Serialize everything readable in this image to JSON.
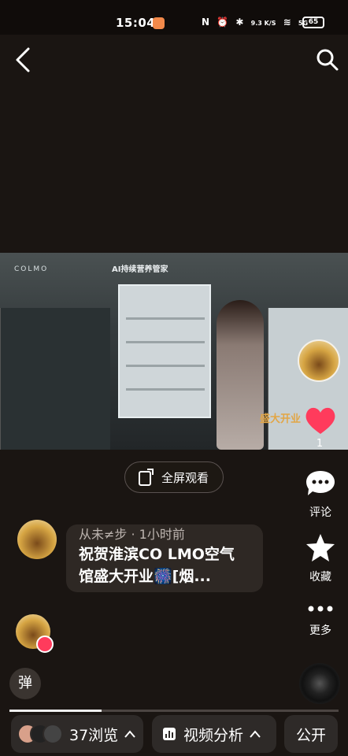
{
  "status_bar": {
    "time": "15:04",
    "net_speed": "9.3 K/S",
    "battery": "65",
    "signal_label": "5G"
  },
  "video": {
    "brand": "COLMO",
    "sign": "AI持续营养管家",
    "overlay_text": "盛大开业"
  },
  "actions": {
    "like_count": "1",
    "comment_label": "评论",
    "favorite_label": "收藏",
    "more_label": "更多"
  },
  "fullscreen": {
    "label": "全屏观看"
  },
  "comment": {
    "meta": "从未≠步 · 1小时前",
    "text_line1": "祝贺淮滨CO LMO空气",
    "text_line2": "馆盛大开业🎆[烟..."
  },
  "danmu": {
    "label": "弹"
  },
  "bottom": {
    "views_label": "37浏览",
    "analysis_label": "视频分析",
    "public_label": "公开"
  },
  "colors": {
    "like": "#ff3b5c",
    "background": "#1a1512",
    "pill": "#2e2a28"
  },
  "icons": [
    "back-icon",
    "search-icon",
    "heart-icon",
    "comment-icon",
    "star-icon",
    "more-icon",
    "fullscreen-icon",
    "chart-icon",
    "chevron-up-icon"
  ]
}
